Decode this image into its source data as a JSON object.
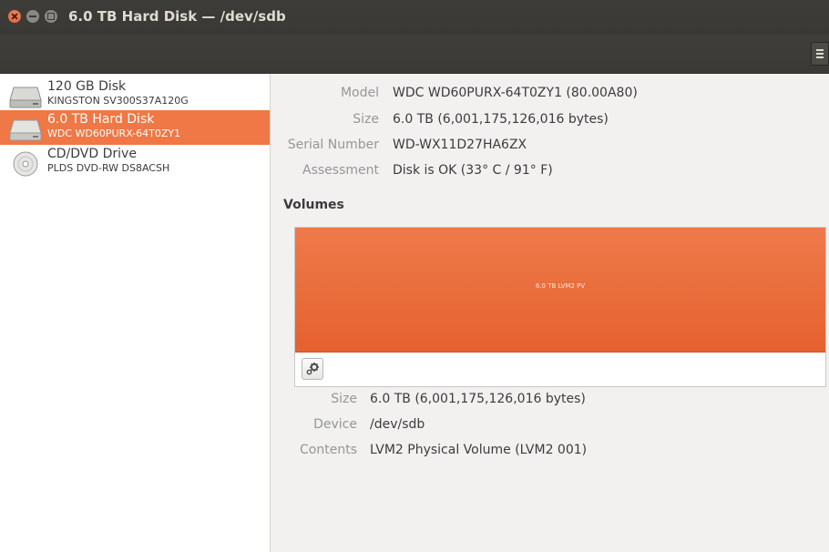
{
  "window": {
    "title": "6.0 TB Hard Disk — /dev/sdb"
  },
  "sidebar": {
    "drives": [
      {
        "name": "120 GB Disk",
        "model": "KINGSTON SV300S37A120G",
        "icon": "hard-disk-icon",
        "selected": false
      },
      {
        "name": "6.0 TB Hard Disk",
        "model": "WDC WD60PURX-64T0ZY1",
        "icon": "hard-disk-icon",
        "selected": true
      },
      {
        "name": "CD/DVD Drive",
        "model": "PLDS DVD-RW DS8ACSH",
        "icon": "optical-disc-icon",
        "selected": false
      }
    ]
  },
  "disk_info": {
    "model_label": "Model",
    "model_value": "WDC WD60PURX-64T0ZY1 (80.00A80)",
    "size_label": "Size",
    "size_value": "6.0 TB (6,001,175,126,016 bytes)",
    "serial_label": "Serial Number",
    "serial_value": "WD-WX11D27HA6ZX",
    "assessment_label": "Assessment",
    "assessment_value": "Disk is OK (33° C / 91° F)"
  },
  "volumes": {
    "heading": "Volumes",
    "partition_label": "6.0 TB LVM2 PV",
    "toolbar_icon": "gear-icon"
  },
  "partition_info": {
    "size_label": "Size",
    "size_value": "6.0 TB (6,001,175,126,016 bytes)",
    "device_label": "Device",
    "device_value": "/dev/sdb",
    "contents_label": "Contents",
    "contents_value": "LVM2 Physical Volume (LVM2 001)"
  },
  "colors": {
    "accent": "#f07746",
    "titlebar": "#3c3b37"
  }
}
